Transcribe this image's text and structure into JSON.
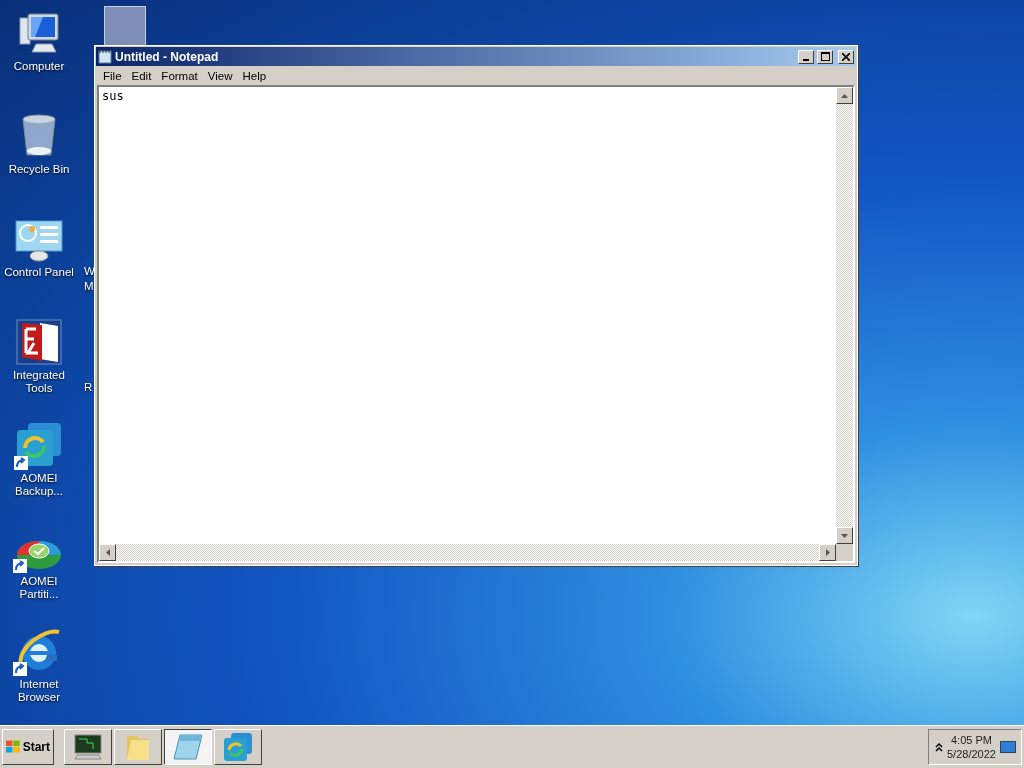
{
  "desktop": {
    "icons": [
      {
        "kind": "computer",
        "label": "Computer",
        "shortcut": false
      },
      {
        "kind": "recycle-bin",
        "label": "Recycle Bin",
        "shortcut": false
      },
      {
        "kind": "control-panel",
        "label": "Control Panel",
        "shortcut": false
      },
      {
        "kind": "ftp",
        "label": "Integrated Tools",
        "shortcut": false
      },
      {
        "kind": "backup",
        "label": "AOMEI Backup...",
        "shortcut": true
      },
      {
        "kind": "partition",
        "label": "AOMEI Partiti...",
        "shortcut": true
      },
      {
        "kind": "browser",
        "label": "Internet Browser",
        "shortcut": true
      }
    ],
    "hidden_column": [
      {
        "kind": "shortcut-tile"
      },
      {
        "kind": "label-only",
        "label_lines": [
          "W",
          "M"
        ]
      },
      {
        "kind": "label-only",
        "label_lines": [
          "R"
        ]
      }
    ]
  },
  "window": {
    "title": "Untitled - Notepad",
    "menu": [
      "File",
      "Edit",
      "Format",
      "View",
      "Help"
    ],
    "text": "sus"
  },
  "taskbar": {
    "start": "Start",
    "buttons": [
      {
        "kind": "terminal",
        "selected": false
      },
      {
        "kind": "folder",
        "selected": false
      },
      {
        "kind": "notepad",
        "selected": true
      },
      {
        "kind": "backup",
        "selected": false
      }
    ],
    "tray": {
      "time": "4:05 PM",
      "date": "5/28/2022"
    }
  }
}
